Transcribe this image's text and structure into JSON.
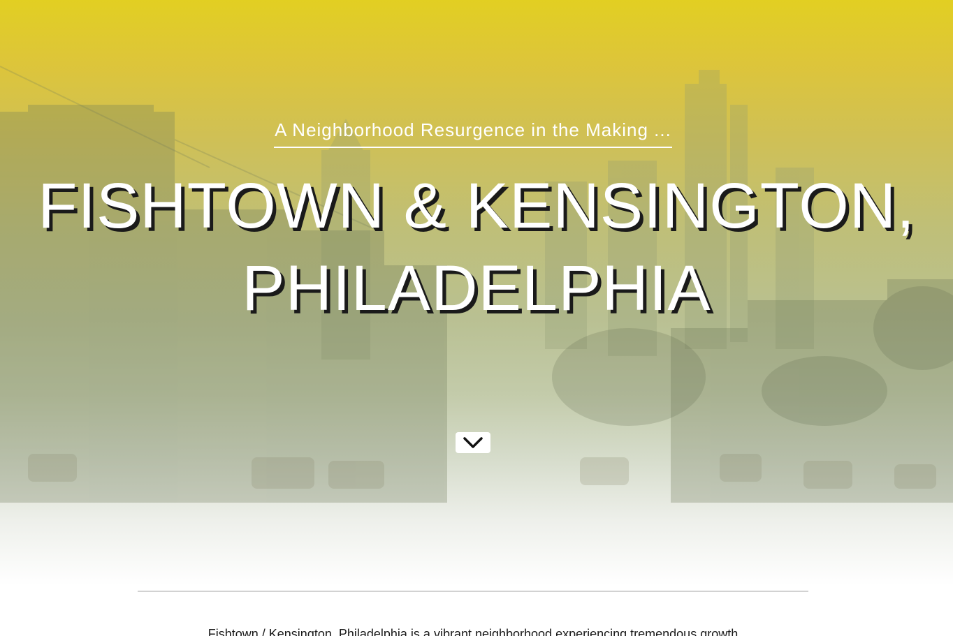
{
  "hero": {
    "subtitle": "A Neighborhood Resurgence in the Making ...",
    "headline_line1": "FISHTOWN & KENSINGTON,",
    "headline_line2": "PHILADELPHIA",
    "scroll_icon": "chevron-down-icon"
  },
  "intro": {
    "text": "Fishtown / Kensington, Philadelphia is a vibrant neighborhood experiencing tremendous growth"
  },
  "colors": {
    "top_tint": "#e2cf22",
    "headline_shadow": "#1a1a1a",
    "divider": "#d2d2d2"
  }
}
